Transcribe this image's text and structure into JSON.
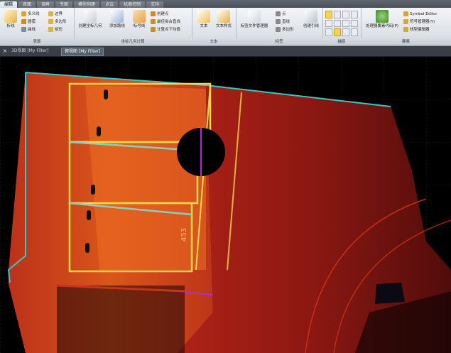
{
  "ribbon_tabs": [
    "编辑",
    "表面",
    "调再",
    "专图",
    "模型创建",
    "点云",
    "机器控制",
    "支持"
  ],
  "active_tab_index": 0,
  "groups": {
    "surface": {
      "title": "表面",
      "big_label": "折线",
      "items": [
        "多义线",
        "圆弧",
        "曲线",
        "边界",
        "多边形",
        "矩形"
      ]
    },
    "coord": {
      "title": "坐标几何计算",
      "big1": "创建坐标几何",
      "big2": "添加路线",
      "big3": "标号线",
      "items": [
        "创建点",
        "最佳拟合直线",
        "计算点下均值"
      ]
    },
    "text": {
      "title": "文本",
      "big1": "文本",
      "big2": "文本样式"
    },
    "label": {
      "title": "标签",
      "big1": "标签文件管理器",
      "items": [
        "点",
        "直线",
        "多边形"
      ],
      "big2": "创建引线"
    },
    "snap": {
      "title": "捕捉"
    },
    "symbol": {
      "title": "要素",
      "big1": "处理器要素代码(P)",
      "items": [
        "Symbol Editor",
        "符号管理器(Y)",
        "线型编辑器"
      ]
    }
  },
  "view_tabs": [
    "3D视图 [My Filter]",
    "俯视图 [My Filter]"
  ],
  "active_view_index": 1,
  "close_glyph": "×",
  "canvas_label": "453",
  "colors": {
    "accent_orange": "#e6561a",
    "cyan_edge": "#35c9c4",
    "yellow_edge": "#f2d84a",
    "magenta": "#b42bd0",
    "background": "#000000"
  }
}
